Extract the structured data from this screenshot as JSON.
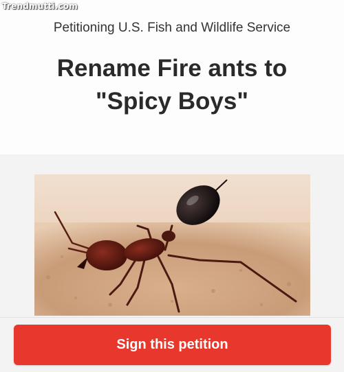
{
  "watermark": "Trendmutti.com",
  "petition": {
    "target": "Petitioning U.S. Fish and Wildlife Service",
    "title": "Rename Fire ants to \"Spicy Boys\""
  },
  "action": {
    "sign_label": "Sign this petition"
  },
  "colors": {
    "button": "#e8372c",
    "text": "#2a2a2a"
  }
}
